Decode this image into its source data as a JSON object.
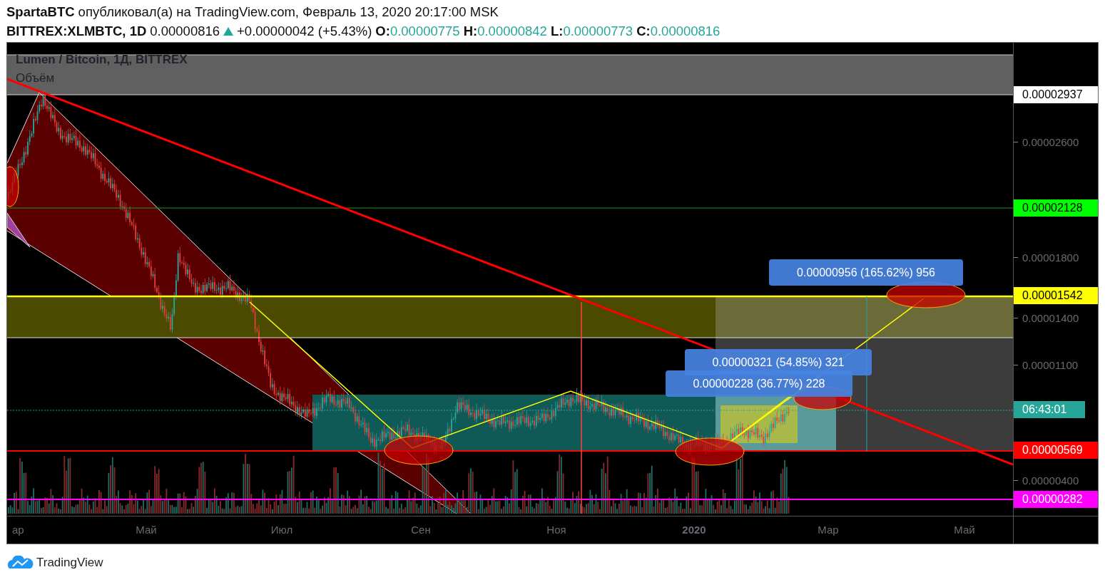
{
  "header": {
    "author": "SpartaBTC",
    "published": "опубликовал(а) на TradingView.com, Февраль 13, 2020 20:17:00 MSK"
  },
  "quote": {
    "symbol": "BITTREX:XLMBTC, 1D",
    "price": "0.00000816",
    "rising": true,
    "change": "+0.00000042 (+5.43%)",
    "ohlc": [
      {
        "label": "O:",
        "value": "0.00000775"
      },
      {
        "label": "H:",
        "value": "0.00000842"
      },
      {
        "label": "L:",
        "value": "0.00000773"
      },
      {
        "label": "C:",
        "value": "0.00000816"
      }
    ]
  },
  "chart": {
    "title": "Lumen / Bitcoin, 1Д, BITTREX",
    "volume_label": "Объём",
    "price_ticks": [
      "0.00002600",
      "0.00001800",
      "0.00001400",
      "0.00001100",
      "0.00000400"
    ],
    "price_labels": [
      {
        "text": "0.00002937",
        "color": "#ffffff"
      },
      {
        "text": "0.00002128",
        "color": "#00ff00"
      },
      {
        "text": "0.00001542",
        "color": "#ffff00"
      },
      {
        "text": "06:43:01",
        "color": "#26a69a"
      },
      {
        "text": "0.00000569",
        "color": "#ff0000"
      },
      {
        "text": "0.00000282",
        "color": "#ff00ff"
      }
    ],
    "time_ticks": [
      {
        "label": "ар",
        "bold": false
      },
      {
        "label": "Май",
        "bold": false
      },
      {
        "label": "Июл",
        "bold": false
      },
      {
        "label": "Сен",
        "bold": false
      },
      {
        "label": "Ноя",
        "bold": false
      },
      {
        "label": "2020",
        "bold": true
      },
      {
        "label": "Мар",
        "bold": false
      },
      {
        "label": "Май",
        "bold": false
      }
    ],
    "measures": [
      {
        "text": "0.00000956 (165.62%) 956"
      },
      {
        "text": "0.00000321 (54.85%) 321"
      },
      {
        "text": "0.00000228 (36.77%) 228"
      }
    ]
  },
  "footer": {
    "brand": "TradingView"
  }
}
